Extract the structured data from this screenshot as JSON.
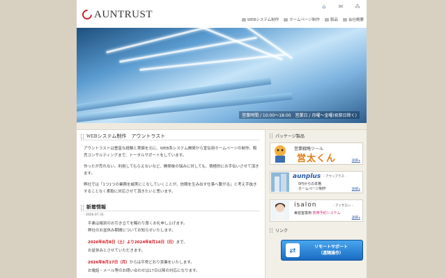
{
  "header": {
    "logo_text": "AUNTRUST",
    "util_icons": [
      "home-icon",
      "mail-icon",
      "sitemap-icon"
    ],
    "nav": [
      {
        "label": "WEBシステム制作",
        "icon": "web-system-icon"
      },
      {
        "label": "ホームページ制作",
        "icon": "homepage-icon"
      },
      {
        "label": "製品",
        "icon": "product-icon"
      },
      {
        "label": "会社概要",
        "icon": "company-icon"
      }
    ]
  },
  "hero": {
    "hours": "営業時間 / 10:00〜18:00　営業日 / 月曜〜金曜(祝祭日除く)"
  },
  "main": {
    "web_title": "WEBシステム制作　アウントラスト",
    "para1": "アウントラストは豊富な経験と実績を元に、WEB系システム開発から宣伝用ホームページの制作、販売コンサルティングまで、トータルサポートをしています。",
    "para2": "作ったが売れない、利用してもらえないなど、開発後の悩みに対しても、積極的にお手伝いさせて頂きます。",
    "para3": "弊社では「1つ1つの業務を誠実にこなしていくことが、信頼を生み出す仕事へ繋がる」と考え手抜きすることなく柔軟に対応させて頂きたいと思います。",
    "news_title": "新着情報",
    "news_date": "- 2026.07.31",
    "news_line1": "平素は格別のお引き立てを賜わり厚くお礼申し上げます。",
    "news_line2": "弊社のお盆休み期間についてお知らせいたします。",
    "news_red1": "2026年8月8日（土）より2024年8月16日（日）",
    "news_suffix1": "まで、",
    "news_line3": "お盆休みとさせていただきます。",
    "news_red2": "2026年8月17日（月）",
    "news_suffix2": "からは平常どおり営業をいたします。",
    "news_line4": "お電話・メール等のお問い合わせは17日以降の対応になります。"
  },
  "sidebar": {
    "package_head": "パッケージ製品",
    "banner1": {
      "label": "営業戦略ツール",
      "name": "営太くん",
      "detail": "詳細"
    },
    "banner2": {
      "logo": "aunplus",
      "sub": "- アウンプラス -",
      "line1": "0円からの本格",
      "line2": "ホームページ制作",
      "detail": "詳細"
    },
    "banner3": {
      "logo": "isalon",
      "sub": "- アイサロン -",
      "line1_a": "美容室専用 ",
      "line1_b": "携帯予約システム",
      "detail": "詳細"
    },
    "link_head": "リンク",
    "remote_line1": "リモートサポート",
    "remote_line2": "（遠隔操作）"
  },
  "colors": {
    "background": "#d8d1c2",
    "accent_red": "#d0141b",
    "remote_blue": "#1a6cc2"
  }
}
